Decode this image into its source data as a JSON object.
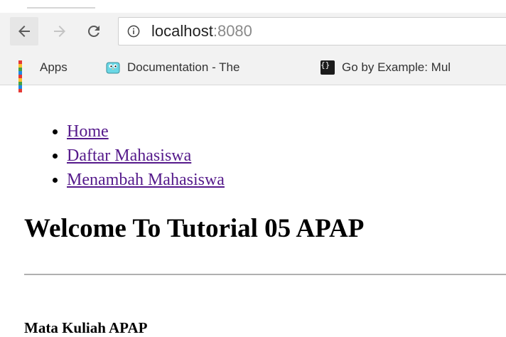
{
  "browser": {
    "url_host": "localhost",
    "url_port": ":8080",
    "bookmarks": [
      {
        "label": "Apps",
        "icon": "apps-grid-icon"
      },
      {
        "label": "Documentation - The",
        "icon": "gopher-icon"
      },
      {
        "label": "Go by Example: Mul",
        "icon": "braces-icon"
      }
    ]
  },
  "page": {
    "nav_links": [
      "Home",
      "Daftar Mahasiswa",
      "Menambah Mahasiswa"
    ],
    "heading": "Welcome To Tutorial 05 APAP",
    "subheading": "Mata Kuliah APAP"
  },
  "colors": {
    "link_visited": "#551a8b",
    "toolbar_bg": "#f2f2f2"
  }
}
